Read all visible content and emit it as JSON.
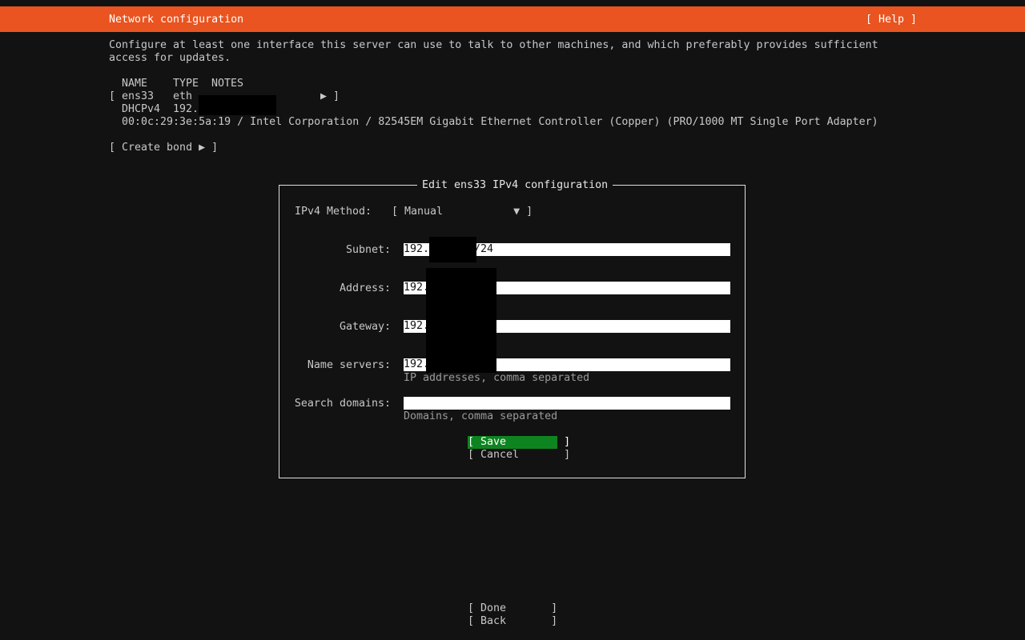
{
  "header": {
    "title": "Network configuration",
    "help": "[ Help ]"
  },
  "intro": "Configure at least one interface this server can use to talk to other machines, and which preferably provides sufficient access for updates.",
  "table": {
    "col_name": "NAME",
    "col_type": "TYPE",
    "col_notes": "NOTES",
    "row_open": "[",
    "iface_name": "ens33",
    "iface_type": "eth",
    "row_arrow": "▶ ]",
    "dhcp_label": "DHCPv4",
    "dhcp_value": "192.",
    "hw_info": "00:0c:29:3e:5a:19 / Intel Corporation / 82545EM Gigabit Ethernet Controller (Copper) (PRO/1000 MT Single Port Adapter)"
  },
  "create_bond": "[ Create bond ▶ ]",
  "dialog": {
    "title": "Edit ens33 IPv4 configuration",
    "method_label": "IPv4 Method:",
    "method_value": "[ Manual           ▼ ]",
    "subnet_label": "Subnet:",
    "subnet_prefix": "192.",
    "subnet_suffix": "/24",
    "address_label": "Address:",
    "address_value": "192.",
    "gateway_label": "Gateway:",
    "gateway_value": "192.",
    "ns_label": "Name servers:",
    "ns_value": "192.",
    "ns_hint": "IP addresses, comma separated",
    "sd_label": "Search domains:",
    "sd_value": "",
    "sd_hint": "Domains, comma separated",
    "save": "[ Save         ]",
    "cancel": "[ Cancel       ]"
  },
  "footer": {
    "done": "[ Done       ]",
    "back": "[ Back       ]"
  },
  "colors": {
    "accent": "#e95420",
    "save_button": "#0e8420",
    "background": "#121212"
  }
}
